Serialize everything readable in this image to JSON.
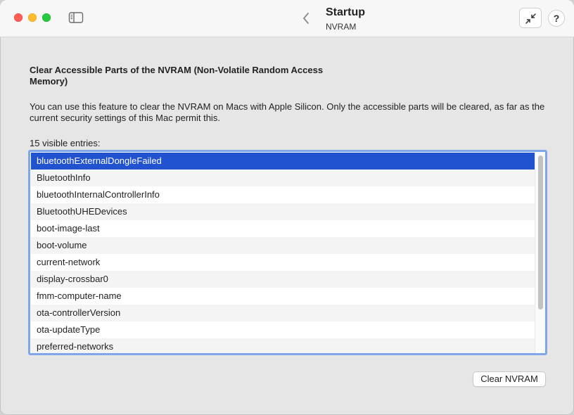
{
  "header": {
    "title": "Startup",
    "subtitle": "NVRAM"
  },
  "content": {
    "heading": "Clear Accessible Parts of the NVRAM (Non-Volatile Random Access Memory)",
    "description": "You can use this feature to clear the NVRAM on Macs with Apple Silicon. Only the accessible parts will be cleared, as far as the current security settings of this Mac permit this.",
    "entries_count_label": "15 visible entries:",
    "entries": [
      {
        "label": "bluetoothExternalDongleFailed",
        "selected": true
      },
      {
        "label": "BluetoothInfo"
      },
      {
        "label": "bluetoothInternalControllerInfo"
      },
      {
        "label": "BluetoothUHEDevices"
      },
      {
        "label": "boot-image-last"
      },
      {
        "label": "boot-volume"
      },
      {
        "label": "current-network"
      },
      {
        "label": "display-crossbar0"
      },
      {
        "label": "fmm-computer-name"
      },
      {
        "label": "ota-controllerVersion"
      },
      {
        "label": "ota-updateType"
      },
      {
        "label": "preferred-networks"
      }
    ],
    "clear_button_label": "Clear NVRAM"
  },
  "toolbar": {
    "help_label": "?"
  },
  "colors": {
    "selection": "#2152d0",
    "focus_ring": "#7ea6e8",
    "close": "#ff5f57",
    "minimize": "#febc2e",
    "zoom": "#28c840"
  },
  "icons": [
    "sidebar-icon",
    "chevron-left-icon",
    "collapse-arrows-icon"
  ]
}
